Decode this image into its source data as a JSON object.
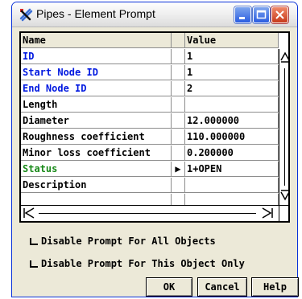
{
  "window": {
    "title": "Pipes - Element Prompt"
  },
  "table": {
    "headers": {
      "name": "Name",
      "value": "Value"
    },
    "rows": [
      {
        "name": "ID",
        "arrow": "",
        "value": "1",
        "color": "#0018e0"
      },
      {
        "name": "Start Node ID",
        "arrow": "",
        "value": "1",
        "color": "#0018e0"
      },
      {
        "name": "End Node ID",
        "arrow": "",
        "value": "2",
        "color": "#0018e0"
      },
      {
        "name": "Length",
        "arrow": "",
        "value": "",
        "color": "#000000"
      },
      {
        "name": "Diameter",
        "arrow": "",
        "value": "12.000000",
        "color": "#000000"
      },
      {
        "name": "Roughness coefficient",
        "arrow": "",
        "value": "110.000000",
        "color": "#000000"
      },
      {
        "name": "Minor loss coefficient",
        "arrow": "",
        "value": "0.200000",
        "color": "#000000"
      },
      {
        "name": "Status",
        "arrow": "▶",
        "value": "1+OPEN",
        "color": "#1a8a1a"
      },
      {
        "name": "Description",
        "arrow": "",
        "value": "",
        "color": "#000000"
      }
    ]
  },
  "options": {
    "disable_all": "Disable Prompt For All Objects",
    "disable_this": "Disable Prompt For This Object Only"
  },
  "buttons": {
    "ok": "OK",
    "cancel": "Cancel",
    "help": "Help"
  }
}
